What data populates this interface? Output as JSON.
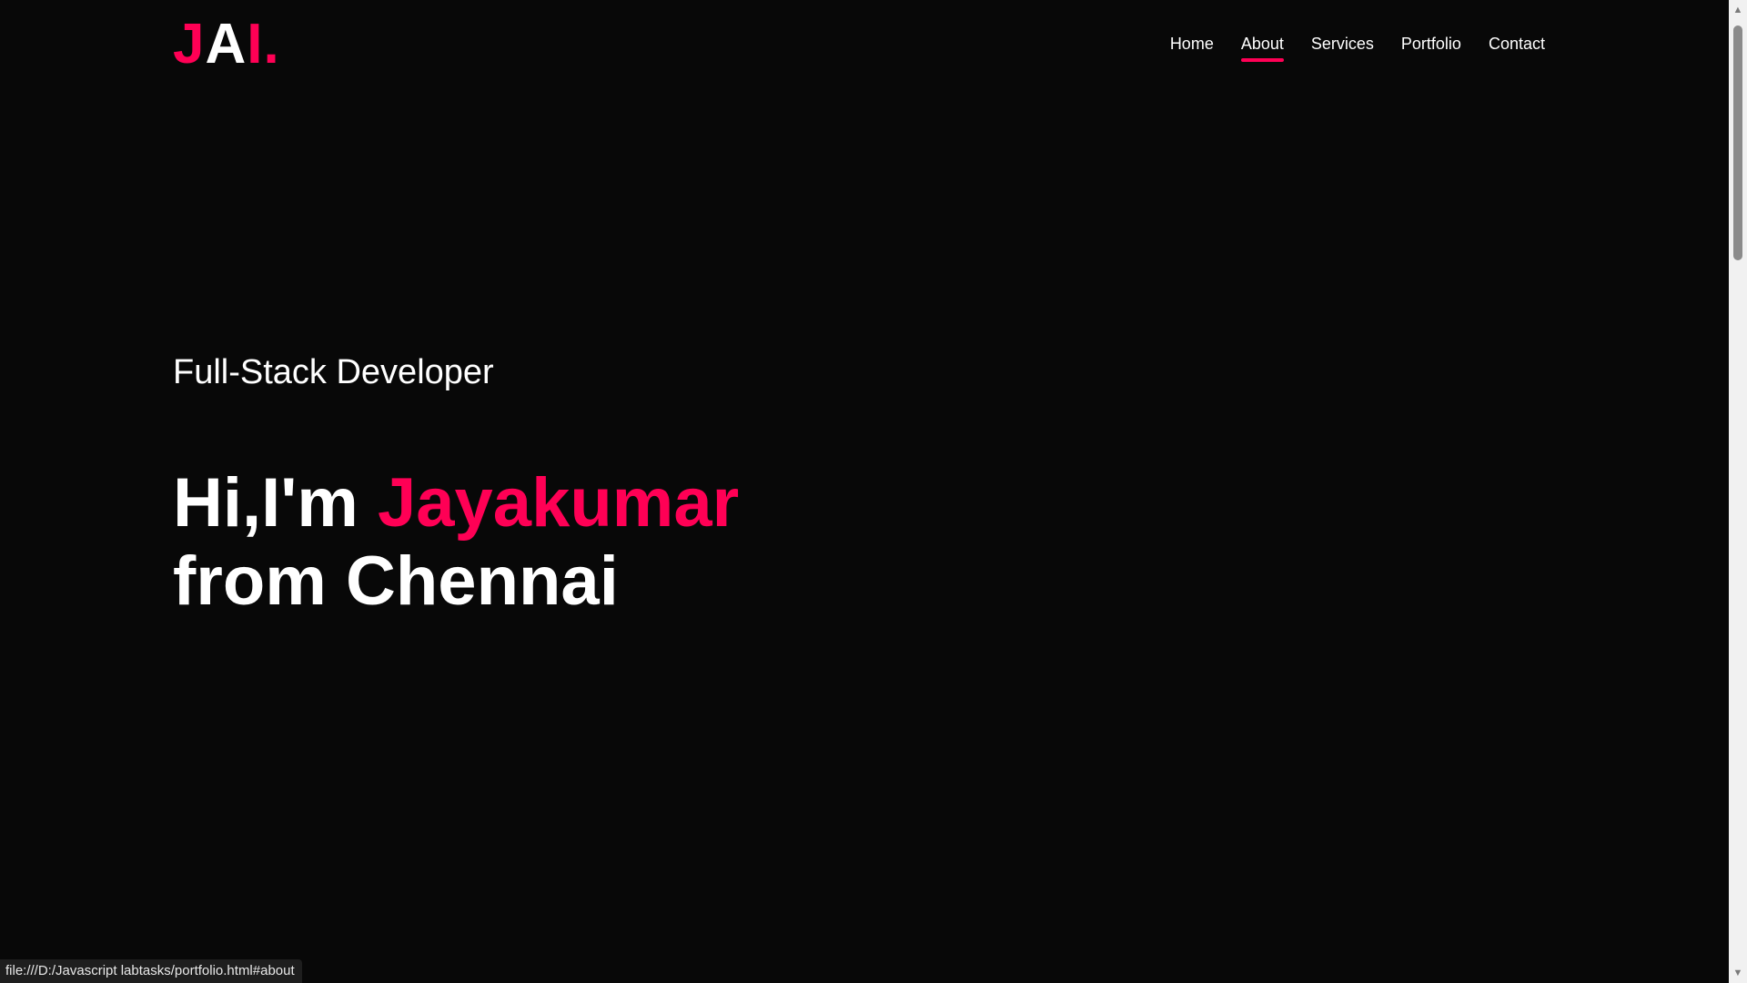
{
  "header": {
    "logo": {
      "part1": "J",
      "part2": "A",
      "part3": "I",
      "part4": "."
    },
    "nav": [
      {
        "label": "Home"
      },
      {
        "label": "About"
      },
      {
        "label": "Services"
      },
      {
        "label": "Portfolio"
      },
      {
        "label": "Contact"
      }
    ],
    "active_nav": "About"
  },
  "hero": {
    "role": "Full-Stack Developer",
    "greeting": "Hi,I'm ",
    "name": "Jayakumar",
    "location": "from Chennai"
  },
  "browser": {
    "status_url": "file:///D:/Javascript labtasks/portfolio.html#about"
  },
  "colors": {
    "accent": "#ff0055",
    "background": "#080808",
    "text": "#ffffff"
  },
  "icons": {
    "scroll_up": "scroll-up-arrow-icon",
    "scroll_down": "scroll-down-arrow-icon"
  }
}
